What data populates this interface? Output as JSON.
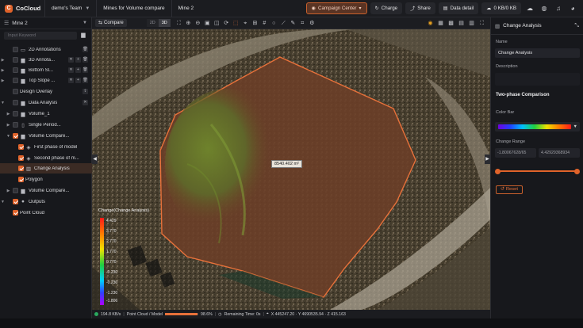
{
  "app": {
    "name": "CoCloud"
  },
  "breadcrumbs": [
    "demo's Team",
    "Mines for Volume compare",
    "Mine 2"
  ],
  "top_buttons": {
    "campaign": "Campaign Center",
    "charge": "Charge",
    "share": "Share",
    "data_detail": "Data detail",
    "storage": "0 KB/0 KB"
  },
  "left": {
    "project": "Mine 2",
    "search_placeholder": "Input Keyword",
    "tree": [
      {
        "label": "2D Annotations",
        "checked": false
      },
      {
        "label": "3D Annota...",
        "checked": false
      },
      {
        "label": "Bottom Sl...",
        "checked": false
      },
      {
        "label": "Top Slope ...",
        "checked": false
      },
      {
        "label": "Design Overlay",
        "checked": false
      },
      {
        "label": "Data Analysis",
        "checked": false
      },
      {
        "label": "Volume_1",
        "checked": false
      },
      {
        "label": "Single Period...",
        "checked": false
      },
      {
        "label": "Volume Compare...",
        "checked": true
      },
      {
        "label": "First phase of model",
        "checked": true
      },
      {
        "label": "Second phase of m...",
        "checked": true
      },
      {
        "label": "Change Analysis",
        "checked": true
      },
      {
        "label": "Polygon",
        "checked": true
      },
      {
        "label": "Volume Compare...",
        "checked": false
      },
      {
        "label": "Outputs",
        "checked": true
      },
      {
        "label": "Point Cloud",
        "checked": true
      }
    ]
  },
  "viewport": {
    "compare_label": "Compare",
    "mode_2d": "2D",
    "mode_3d": "3D",
    "area_label": "8540.402 m²",
    "legend": {
      "title": "Change(Change Analysis)",
      "values": [
        "4.429",
        "3.770",
        "2.770",
        "1.770",
        "0.770",
        "-0.230",
        "-0.230",
        "-1.230",
        "-1.806"
      ]
    }
  },
  "status": {
    "speed": "194.8 KB/s",
    "pc_model": "Point Cloud / Model",
    "percent": "98.6%",
    "progress": 0.986,
    "remaining": "Remaining Time: 0s",
    "coords": "X 445247.20 · Y 4690535.94 · Z 415.163"
  },
  "right": {
    "header": "Change Analysis",
    "name_label": "Name",
    "name_value": "Change Analysis",
    "desc_label": "Description",
    "section": "Two-phase Comparison",
    "colorbar_label": "Color Bar",
    "range_label": "Change Range",
    "range_min": "-1.80067628/65",
    "range_max": "4.42929368934",
    "reset": "Reset"
  },
  "colors": {
    "accent": "#e0632a",
    "panel": "#17181c",
    "topbar": "#1b1c20"
  }
}
